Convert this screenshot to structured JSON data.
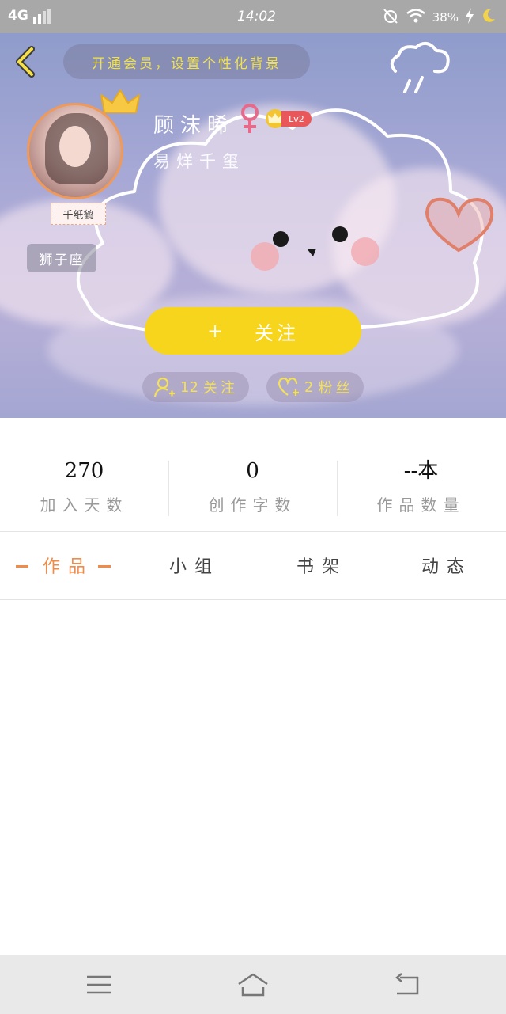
{
  "status_bar": {
    "network": "4G",
    "time": "14:02",
    "battery": "38%"
  },
  "header": {
    "tip": "开通会员，设置个性化背景",
    "username": "顾沫晞",
    "level": "Lv2",
    "pendant_label": "千纸鹤",
    "zodiac": "狮子座",
    "signature": "易烊千玺",
    "follow_label": "关注",
    "following": {
      "count": "12",
      "label": "关注"
    },
    "fans": {
      "count": "2",
      "label": "粉丝"
    }
  },
  "stats": [
    {
      "value": "270",
      "label": "加入天数"
    },
    {
      "value": "0",
      "label": "创作字数"
    },
    {
      "value": "--本",
      "label": "作品数量"
    }
  ],
  "tabs": [
    {
      "label": "作品",
      "active": true
    },
    {
      "label": "小组",
      "active": false
    },
    {
      "label": "书架",
      "active": false
    },
    {
      "label": "动态",
      "active": false
    }
  ],
  "colors": {
    "accent_yellow": "#f6d51c",
    "accent_orange": "#ef8c4a",
    "level_red": "#e8585a"
  }
}
